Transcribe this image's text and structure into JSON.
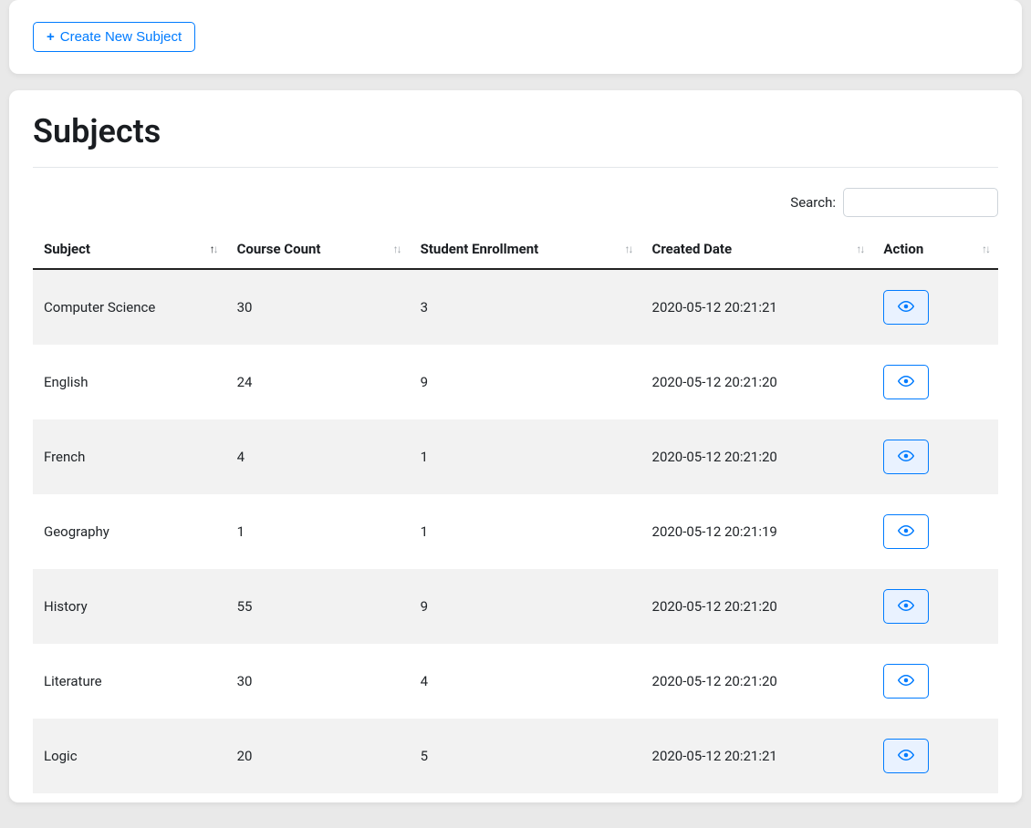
{
  "toolbar": {
    "create_label": "Create New Subject"
  },
  "page": {
    "title": "Subjects"
  },
  "search": {
    "label": "Search:",
    "value": ""
  },
  "table": {
    "columns": {
      "subject": "Subject",
      "course_count": "Course Count",
      "student_enrollment": "Student Enrollment",
      "created_date": "Created Date",
      "action": "Action"
    },
    "rows": [
      {
        "subject": "Computer Science",
        "course_count": "30",
        "student_enrollment": "3",
        "created_date": "2020-05-12 20:21:21"
      },
      {
        "subject": "English",
        "course_count": "24",
        "student_enrollment": "9",
        "created_date": "2020-05-12 20:21:20"
      },
      {
        "subject": "French",
        "course_count": "4",
        "student_enrollment": "1",
        "created_date": "2020-05-12 20:21:20"
      },
      {
        "subject": "Geography",
        "course_count": "1",
        "student_enrollment": "1",
        "created_date": "2020-05-12 20:21:19"
      },
      {
        "subject": "History",
        "course_count": "55",
        "student_enrollment": "9",
        "created_date": "2020-05-12 20:21:20"
      },
      {
        "subject": "Literature",
        "course_count": "30",
        "student_enrollment": "4",
        "created_date": "2020-05-12 20:21:20"
      },
      {
        "subject": "Logic",
        "course_count": "20",
        "student_enrollment": "5",
        "created_date": "2020-05-12 20:21:21"
      }
    ]
  }
}
